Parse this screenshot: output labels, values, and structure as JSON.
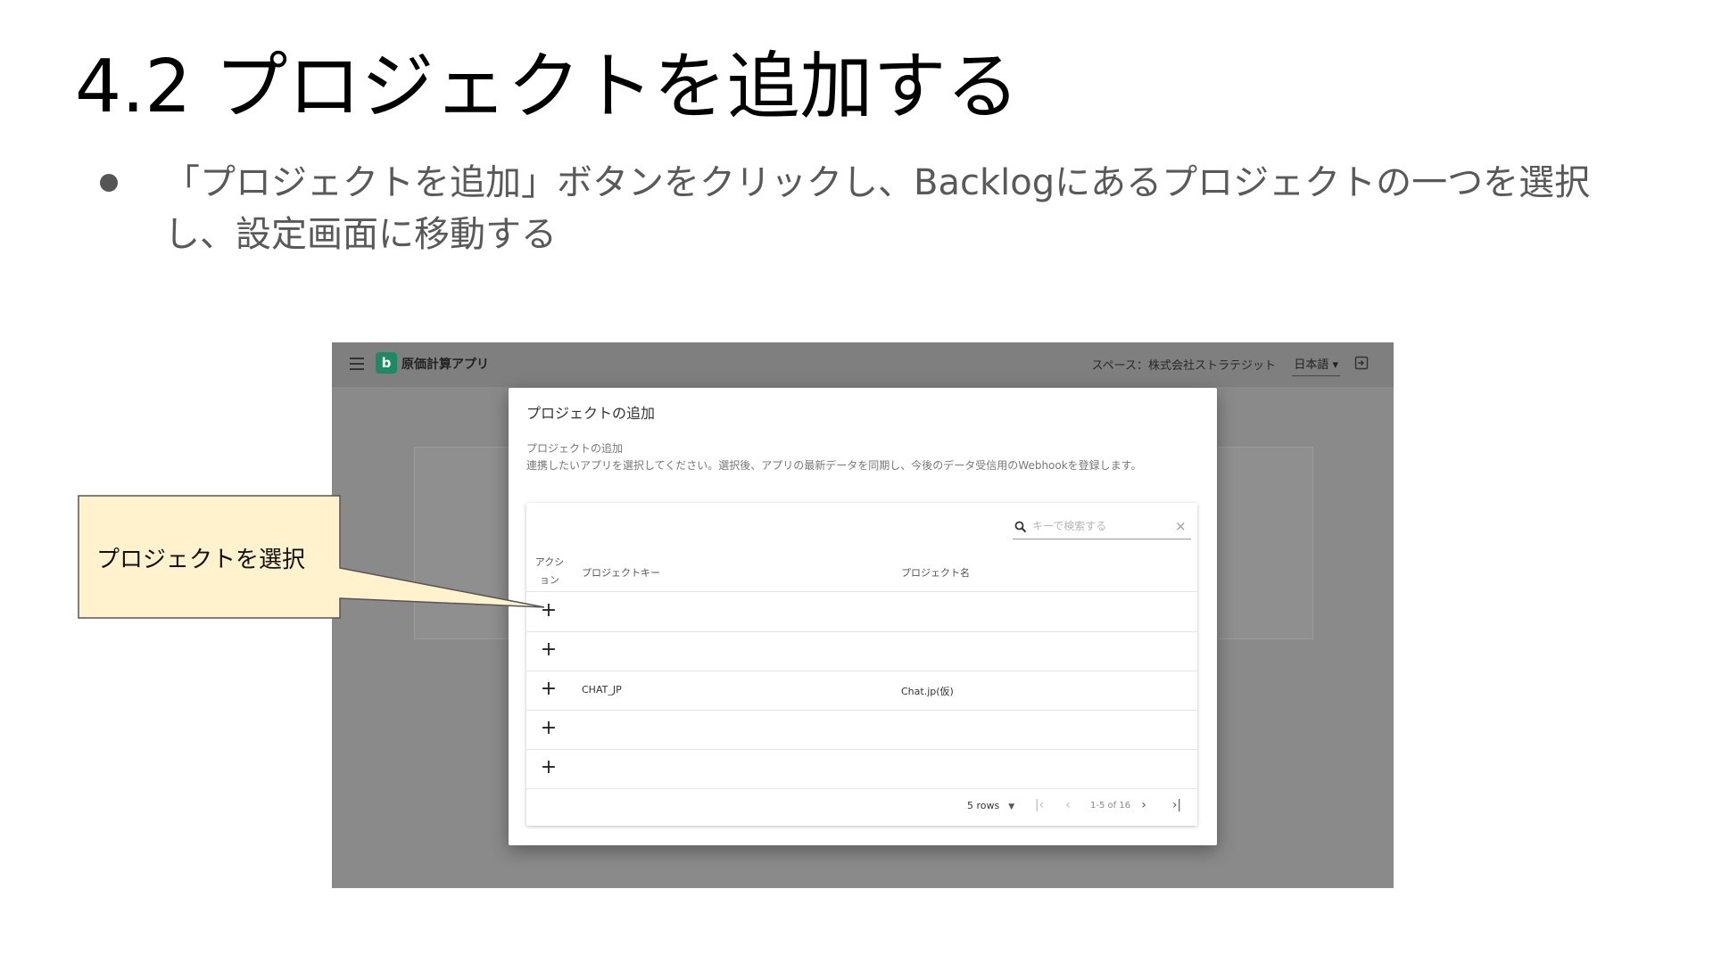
{
  "slide": {
    "title": "4.2 プロジェクトを追加する",
    "bullet": "「プロジェクトを追加」ボタンをクリックし、Backlogにあるプロジェクトの一つを選択し、設定画面に移動する"
  },
  "app": {
    "title": "原価計算アプリ",
    "logo_letter": "b",
    "space_label": "スペース：株式会社ストラテジット",
    "language": "日本語 ▾",
    "brand_color": "#1d8a63"
  },
  "dialog": {
    "title": "プロジェクトの追加",
    "subtitle": "プロジェクトの追加",
    "description": "連携したいアプリを選択してください。選択後、アプリの最新データを同期し、今後のデータ受信用のWebhookを登録します。",
    "search_placeholder": "キーで検索する",
    "columns": {
      "action": "アクション",
      "key": "プロジェクトキー",
      "name": "プロジェクト名"
    },
    "rows": [
      {
        "key": "",
        "name": ""
      },
      {
        "key": "",
        "name": ""
      },
      {
        "key": "CHAT_JP",
        "name": "Chat.jp(仮)"
      },
      {
        "key": "",
        "name": ""
      },
      {
        "key": "",
        "name": ""
      }
    ],
    "add_symbol": "+",
    "footer": {
      "rows_per_page": "5 rows",
      "page_info": "1-5 of 16"
    }
  },
  "callout": {
    "text": "プロジェクトを選択"
  }
}
